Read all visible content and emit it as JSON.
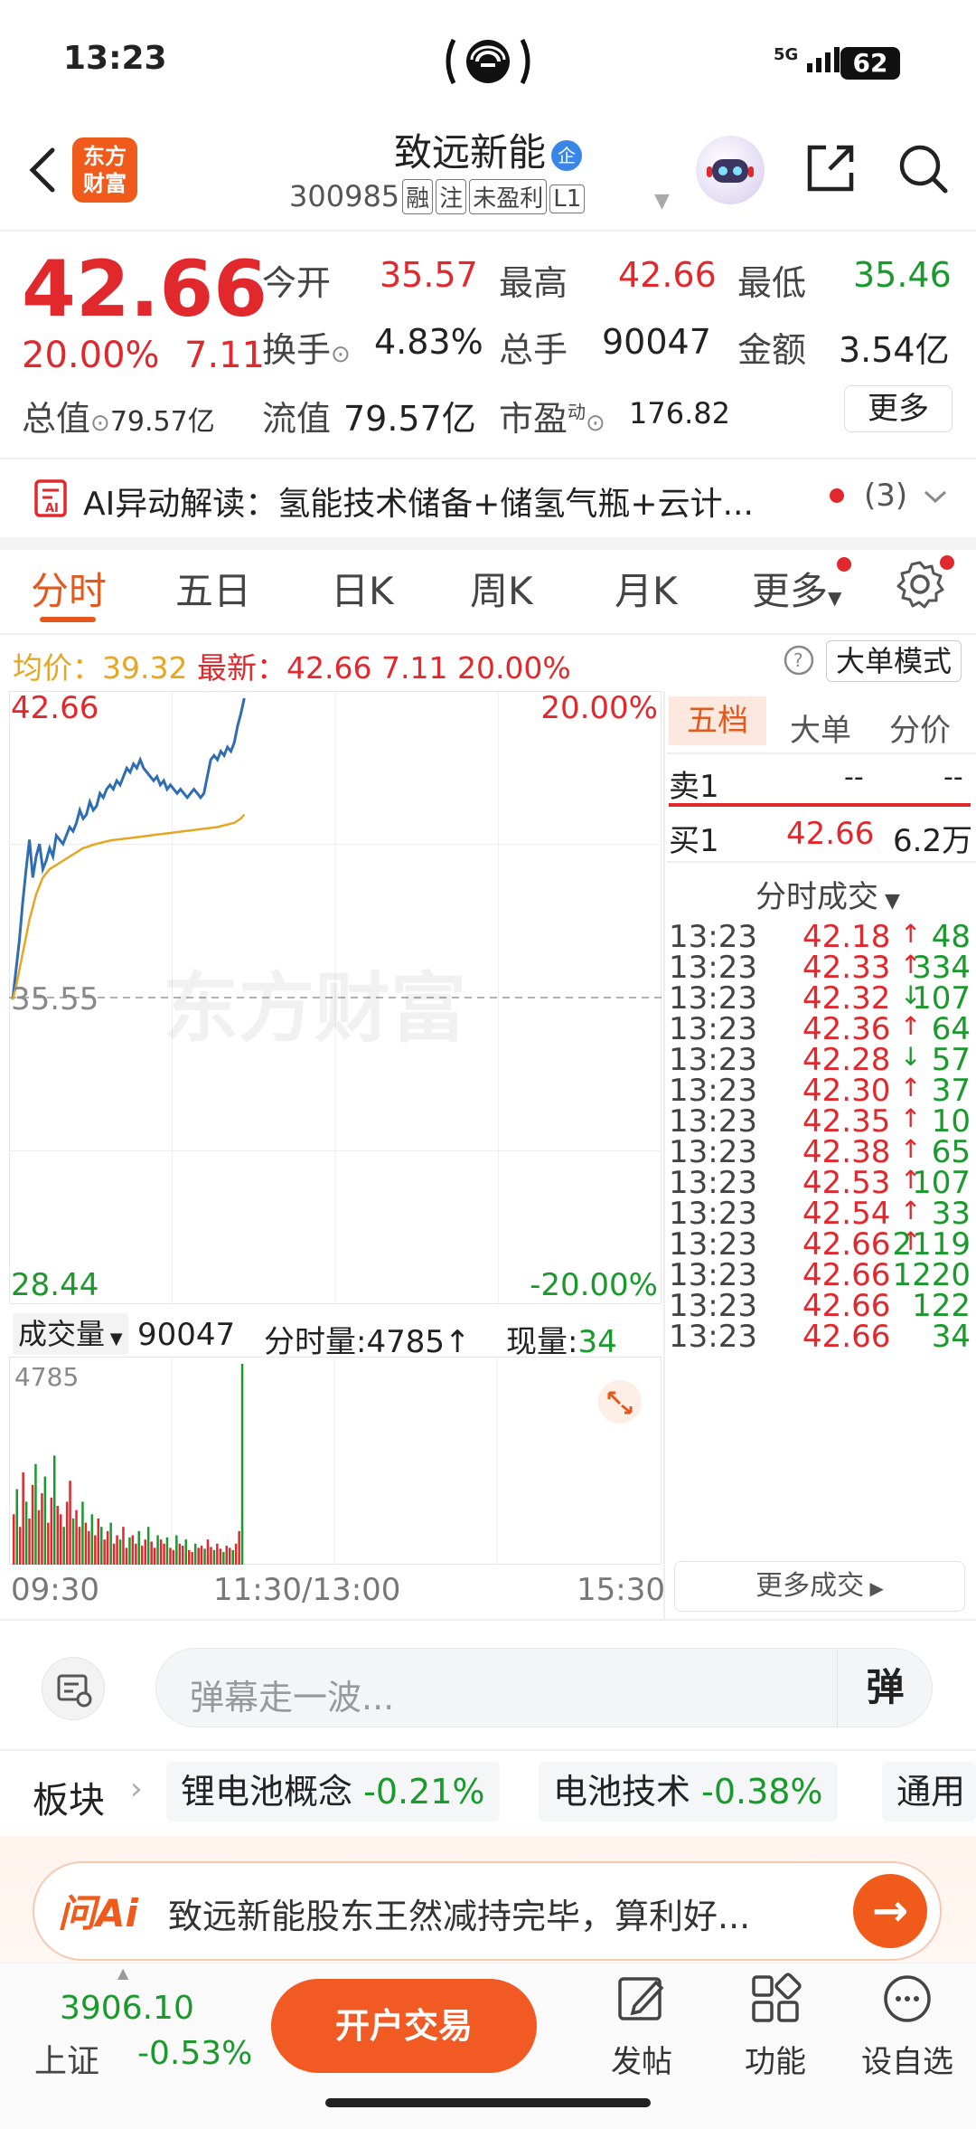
{
  "status": {
    "time": "13:23",
    "network": "5G",
    "battery": "62"
  },
  "header": {
    "logo_line1": "东方",
    "logo_line2": "财富",
    "stock_name": "致远新能",
    "badge": "企",
    "code": "300985",
    "tags": [
      "融",
      "注",
      "未盈利",
      "L1"
    ]
  },
  "quote": {
    "price": "42.66",
    "change_pct": "20.00%",
    "change": "7.11",
    "open_label": "今开",
    "open": "35.57",
    "high_label": "最高",
    "high": "42.66",
    "low_label": "最低",
    "low": "35.46",
    "turnover_label": "换手",
    "turnover": "4.83%",
    "volume_label": "总手",
    "volume": "90047",
    "amount_label": "金额",
    "amount": "3.54亿",
    "mktcap_label": "总值",
    "mktcap": "79.57亿",
    "float_label": "流值",
    "float": "79.57亿",
    "pe_label": "市盈",
    "pe_sup": "动",
    "pe": "176.82",
    "more": "更多"
  },
  "ai_bar": {
    "text": "AI异动解读：氢能技术储备+储氢气瓶+云计...",
    "count": "(3)"
  },
  "tabs": [
    "分时",
    "五日",
    "日K",
    "周K",
    "月K",
    "更多"
  ],
  "avg_line": {
    "avg_label": "均价：",
    "avg": "39.32",
    "latest_label": "最新：",
    "latest": "42.66",
    "latest_chg": "7.11",
    "latest_pct": "20.00%",
    "mode": "大单模式"
  },
  "chart_data": {
    "type": "line",
    "title": "",
    "y_max_label": "42.66",
    "y_max_pct": "20.00%",
    "y_mid_label": "35.55",
    "y_min_label": "28.44",
    "y_min_pct": "-20.00%",
    "ylim": [
      28.44,
      42.66
    ],
    "x_ticks": [
      "09:30",
      "11:30/13:00",
      "15:30"
    ],
    "watermark": "东方财富",
    "series": [
      {
        "name": "",
        "color": "#2f6db3",
        "values": [
          35.5,
          36.2,
          36.9,
          37.8,
          38.6,
          39.3,
          38.4,
          38.9,
          39.2,
          38.6,
          38.8,
          39.1,
          38.9,
          39.4,
          39.3,
          39.2,
          39.4,
          39.6,
          39.5,
          39.7,
          40.0,
          39.8,
          39.9,
          40.2,
          40.0,
          40.1,
          40.4,
          40.3,
          40.5,
          40.6,
          40.5,
          40.7,
          40.6,
          40.8,
          41.0,
          40.9,
          41.1,
          41.0,
          41.2,
          41.0,
          40.9,
          40.8,
          40.7,
          40.8,
          40.6,
          40.7,
          40.5,
          40.6,
          40.5,
          40.4,
          40.5,
          40.4,
          40.3,
          40.4,
          40.5,
          40.4,
          40.3,
          40.4,
          40.8,
          41.2,
          41.3,
          41.2,
          41.4,
          41.3,
          41.5,
          41.4,
          41.6,
          42.0,
          42.3,
          42.66
        ]
      },
      {
        "name": "",
        "color": "#e6a623",
        "values": [
          35.5,
          35.8,
          36.2,
          36.6,
          37.0,
          37.4,
          37.7,
          38.0,
          38.2,
          38.4,
          38.5,
          38.6,
          38.65,
          38.7,
          38.75,
          38.8,
          38.85,
          38.9,
          38.95,
          39.0,
          39.05,
          39.1,
          39.12,
          39.15,
          39.18,
          39.2,
          39.22,
          39.24,
          39.26,
          39.28,
          39.29,
          39.3,
          39.31,
          39.32,
          39.33,
          39.34,
          39.35,
          39.36,
          39.37,
          39.38,
          39.39,
          39.4,
          39.41,
          39.42,
          39.43,
          39.44,
          39.45,
          39.46,
          39.47,
          39.48,
          39.49,
          39.5,
          39.51,
          39.52,
          39.53,
          39.54,
          39.55,
          39.56,
          39.57,
          39.58,
          39.59,
          39.6,
          39.62,
          39.64,
          39.66,
          39.68,
          39.7,
          39.75,
          39.8,
          39.9
        ]
      }
    ]
  },
  "volume": {
    "label": "成交量",
    "total": "90047",
    "tick_label": "分时量:",
    "tick_value": "4785",
    "now_label": "现量:",
    "now_value": "34",
    "max_label": "4785",
    "bars": [
      1200,
      1800,
      900,
      2200,
      1500,
      1100,
      1900,
      2400,
      1300,
      1700,
      2100,
      1000,
      1600,
      2600,
      1400,
      1200,
      900,
      1500,
      2000,
      1100,
      1300,
      900,
      1500,
      1000,
      800,
      1200,
      700,
      1100,
      900,
      600,
      800,
      1000,
      500,
      700,
      600,
      900,
      400,
      650,
      700,
      500,
      800,
      450,
      600,
      900,
      550,
      400,
      700,
      600,
      500,
      650,
      400,
      350,
      700,
      500,
      450,
      600,
      350,
      300,
      500,
      400,
      450,
      380,
      600,
      420,
      350,
      500,
      380,
      300,
      450,
      400,
      350,
      500,
      800,
      4785
    ]
  },
  "panel": {
    "segments": [
      "五档",
      "大单",
      "分价"
    ],
    "sell1": {
      "label": "卖1",
      "price": "--",
      "vol": "--"
    },
    "buy1": {
      "label": "买1",
      "price": "42.66",
      "vol": "6.2万"
    },
    "trades_title": "分时成交",
    "trades": [
      {
        "time": "13:23",
        "price": "42.18",
        "dir": "↑",
        "vol": "48"
      },
      {
        "time": "13:23",
        "price": "42.33",
        "dir": "↑",
        "vol": "334"
      },
      {
        "time": "13:23",
        "price": "42.32",
        "dir": "↓",
        "vol": "107"
      },
      {
        "time": "13:23",
        "price": "42.36",
        "dir": "↑",
        "vol": "64"
      },
      {
        "time": "13:23",
        "price": "42.28",
        "dir": "↓",
        "vol": "57"
      },
      {
        "time": "13:23",
        "price": "42.30",
        "dir": "↑",
        "vol": "37"
      },
      {
        "time": "13:23",
        "price": "42.35",
        "dir": "↑",
        "vol": "10"
      },
      {
        "time": "13:23",
        "price": "42.38",
        "dir": "↑",
        "vol": "65"
      },
      {
        "time": "13:23",
        "price": "42.53",
        "dir": "↑",
        "vol": "107"
      },
      {
        "time": "13:23",
        "price": "42.54",
        "dir": "↑",
        "vol": "33"
      },
      {
        "time": "13:23",
        "price": "42.66",
        "dir": "↑",
        "vol": "2119"
      },
      {
        "time": "13:23",
        "price": "42.66",
        "dir": "",
        "vol": "1220"
      },
      {
        "time": "13:23",
        "price": "42.66",
        "dir": "",
        "vol": "122"
      },
      {
        "time": "13:23",
        "price": "42.66",
        "dir": "",
        "vol": "34"
      }
    ],
    "more_trades": "更多成交"
  },
  "comment": {
    "placeholder": "弹幕走一波...",
    "btn": "弹"
  },
  "sectors": {
    "label": "板块",
    "items": [
      {
        "name": "锂电池概念",
        "chg": "-0.21%"
      },
      {
        "name": "电池技术",
        "chg": "-0.38%"
      },
      {
        "name": "通用",
        "chg": ""
      }
    ]
  },
  "ai_ask": {
    "logo": "问Ai",
    "text": "致远新能股东王然减持完毕，算利好..."
  },
  "bottom": {
    "index_value": "3906.10",
    "index_name": "上证",
    "index_chg": "-0.53%",
    "open_account": "开户交易",
    "nav": [
      "发帖",
      "功能",
      "设自选"
    ]
  }
}
